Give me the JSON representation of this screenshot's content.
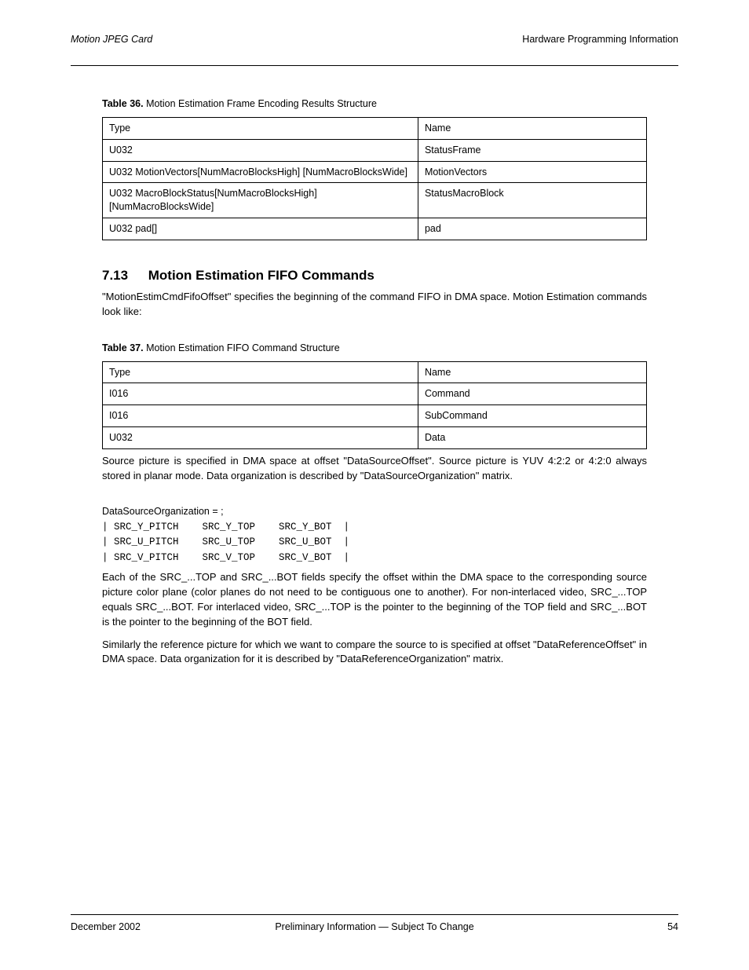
{
  "header": {
    "left_italic": "Motion JPEG Card",
    "right": "Hardware Programming Information"
  },
  "table1": {
    "caption_num": "Table 36.",
    "caption_text": "Motion Estimation Frame Encoding Results Structure",
    "rows": [
      [
        "Type",
        "Name"
      ],
      [
        "U032",
        "StatusFrame"
      ],
      [
        "U032 MotionVectors[NumMacroBlocksHigh] [NumMacroBlocksWide]",
        "MotionVectors"
      ],
      [
        "U032 MacroBlockStatus[NumMacroBlocksHigh] [NumMacroBlocksWide]",
        "StatusMacroBlock"
      ],
      [
        "U032 pad[]",
        "pad"
      ]
    ]
  },
  "section": {
    "num": "7.13",
    "title": "Motion Estimation FIFO Commands"
  },
  "para1": "\"MotionEstimCmdFifoOffset\" specifies the beginning of the command FIFO in DMA space. Motion Estimation commands look like:",
  "table2": {
    "caption_num": "Table 37.",
    "caption_text": "Motion Estimation FIFO Command Structure",
    "rows": [
      [
        "Type",
        "Name"
      ],
      [
        "I016",
        "Command"
      ],
      [
        "I016",
        "SubCommand"
      ],
      [
        "U032",
        "Data"
      ]
    ]
  },
  "para2": "Source picture is specified in DMA space at offset \"DataSourceOffset\". Source picture is YUV 4:2:2 or 4:2:0 always stored in planar mode. Data organization is described by \"DataSourceOrganization\" matrix.",
  "matrix": {
    "label": "DataSourceOrganization = ;",
    "rows": [
      "| SRC_Y_PITCH    SRC_Y_TOP    SRC_Y_BOT  |",
      "| SRC_U_PITCH    SRC_U_TOP    SRC_U_BOT  |",
      "| SRC_V_PITCH    SRC_V_TOP    SRC_V_BOT  |"
    ]
  },
  "para3": "Each of the SRC_...TOP and SRC_...BOT fields specify the offset within the DMA space to the corresponding source picture color plane (color planes do not need to be contiguous one to another). For non-interlaced video, SRC_...TOP equals SRC_...BOT. For interlaced video, SRC_...TOP is the pointer to the beginning of the TOP field and SRC_...BOT is the pointer to the beginning of the BOT field.",
  "para4": "Similarly the reference picture for which we want to compare the source to is specified at offset \"DataReferenceOffset\" in DMA space. Data organization for it is described by \"DataReferenceOrganization\" matrix.",
  "footer": {
    "left": "December 2002",
    "center": "Preliminary Information — Subject To Change",
    "right": "54"
  }
}
